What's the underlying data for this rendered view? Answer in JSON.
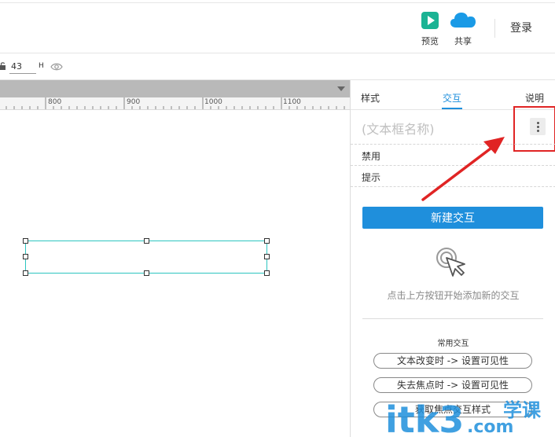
{
  "toolbar": {
    "preview_label": "预览",
    "share_label": "共享",
    "login_label": "登录"
  },
  "propbar": {
    "h_value": "43",
    "h_label": "H"
  },
  "ruler": {
    "labels": [
      "800",
      "900",
      "1000",
      "1100"
    ]
  },
  "panel": {
    "tabs": {
      "style": "样式",
      "interact": "交互",
      "notes": "说明"
    },
    "widget_name_placeholder": "(文本框名称)",
    "props": [
      "禁用",
      "提示"
    ],
    "new_interaction": "新建交互",
    "hint": "点击上方按钮开始添加新的交互",
    "common_title": "常用交互",
    "common_items": [
      "文本改变时 -> 设置可见性",
      "失去焦点时 -> 设置可见性",
      "获取焦点交互样式"
    ]
  },
  "colors": {
    "accent": "#1f8fdc",
    "selection": "#2dc5c0",
    "annotation": "#e02424",
    "preview_green": "#1bb394"
  },
  "watermark": {
    "text": "itk3",
    "sub": ".com",
    "cn": "学课"
  }
}
